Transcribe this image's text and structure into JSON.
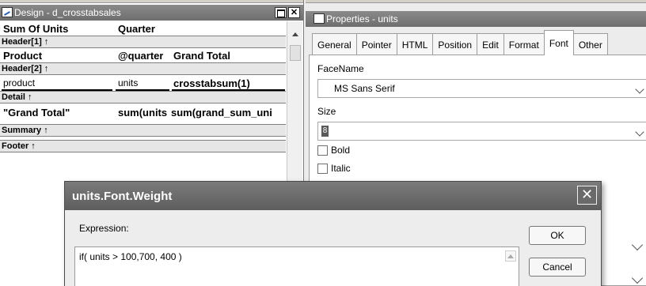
{
  "design_window": {
    "title": "Design - d_crosstabsales",
    "header_row": {
      "col1": "Sum Of Units",
      "col2": "Quarter"
    },
    "bands": {
      "header1": "Header[1] ↑",
      "header2": "Header[2] ↑",
      "detail": "Detail ↑",
      "summary": "Summary ↑",
      "footer": "Footer ↑"
    },
    "header1_row": {
      "col1": "Product",
      "col2": "@quarter",
      "col3": "Grand Total"
    },
    "header2_row": {
      "col1": "product",
      "col2": "units",
      "col3": "crosstabsum(1)"
    },
    "detail_row": {
      "col1": "\"Grand Total\"",
      "col2": "sum(units",
      "col3": "sum(grand_sum_uni"
    }
  },
  "properties_window": {
    "title": "Properties - units",
    "tabs": [
      "General",
      "Pointer",
      "HTML",
      "Position",
      "Edit",
      "Format",
      "Font",
      "Other"
    ],
    "active_tab": "Font",
    "facename_label": "FaceName",
    "facename_value": "MS Sans Serif",
    "size_label": "Size",
    "size_value": "8",
    "bold_label": "Bold",
    "italic_label": "Italic"
  },
  "dialog": {
    "title": "units.Font.Weight",
    "expression_label": "Expression:",
    "expression_value": "if( units > 100,700, 400 )",
    "ok_label": "OK",
    "cancel_label": "Cancel",
    "close_glyph": "✕"
  },
  "icons": {
    "window_close_glyph": "✕"
  }
}
